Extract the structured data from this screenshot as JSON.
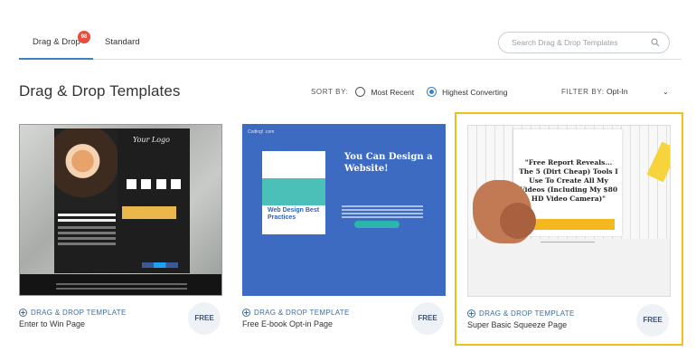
{
  "tabs": [
    {
      "label": "Drag & Drop",
      "badge": "98",
      "active": true
    },
    {
      "label": "Standard",
      "active": false
    }
  ],
  "search": {
    "placeholder": "Search Drag & Drop Templates",
    "icon": "search-icon"
  },
  "page_title": "Drag & Drop Templates",
  "sort": {
    "label": "SORT BY:",
    "options": [
      {
        "label": "Most Recent",
        "selected": false
      },
      {
        "label": "Highest Converting",
        "selected": true
      }
    ]
  },
  "filter": {
    "label": "FILTER BY:",
    "value": "Opt-In",
    "icon": "chevron-down-icon"
  },
  "cards": [
    {
      "type": "DRAG & DROP TEMPLATE",
      "name": "Enter to Win Page",
      "price": "FREE",
      "thumb": {
        "logo": "Your Logo"
      }
    },
    {
      "type": "DRAG & DROP TEMPLATE",
      "name": "Free E-book Opt-in Page",
      "price": "FREE",
      "thumb": {
        "tag": "Coding! .com",
        "headline": "You Can Design a Website!",
        "book_title": "Web Design Best Practices"
      }
    },
    {
      "type": "DRAG & DROP TEMPLATE",
      "name": "Super Basic Squeeze Page",
      "price": "FREE",
      "selected": true,
      "thumb": {
        "headline": "\"Free Report Reveals... The 5 (Dirt Cheap) Tools I Use To Create All My Videos (Including My $80 HD Video Camera)\""
      }
    }
  ],
  "colors": {
    "accent": "#3b82c4",
    "badge": "#e74c3c",
    "selected_border": "#f0c020"
  }
}
